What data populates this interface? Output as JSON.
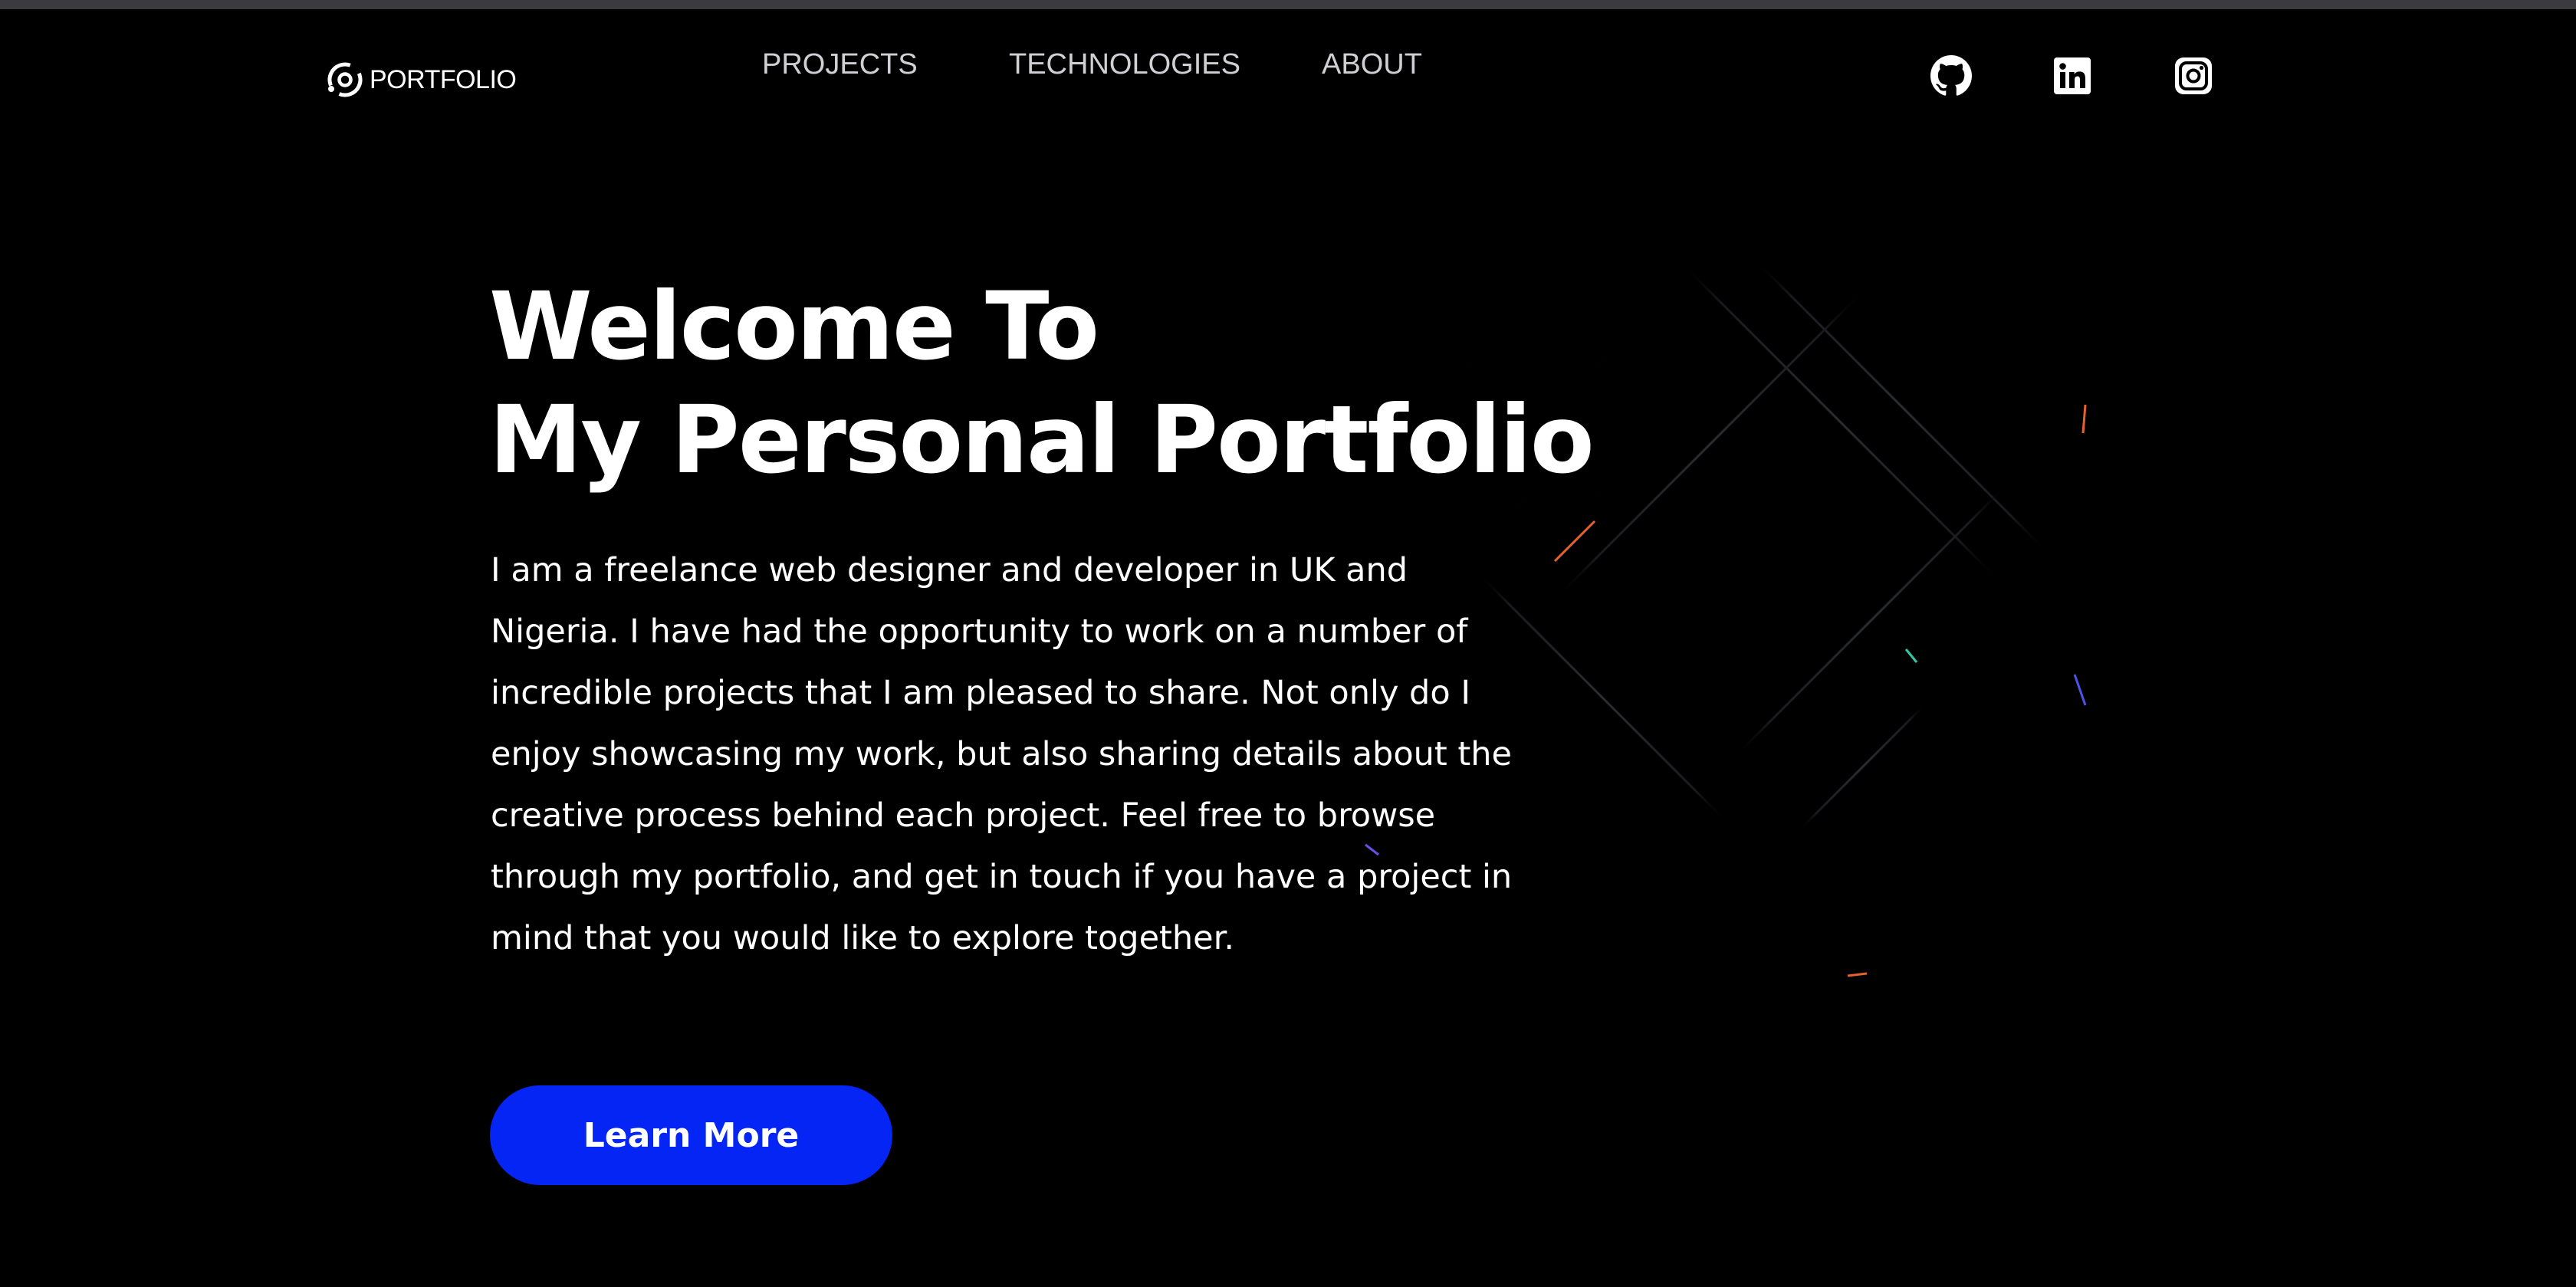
{
  "brand": {
    "logo_text": "PORTFOLIO",
    "logo_icon": "portfolio-ring-icon"
  },
  "nav": {
    "items": [
      {
        "label": "PROJECTS"
      },
      {
        "label": "TECHNOLOGIES"
      },
      {
        "label": "ABOUT"
      }
    ]
  },
  "social": [
    {
      "icon": "github-icon"
    },
    {
      "icon": "linkedin-icon"
    },
    {
      "icon": "instagram-icon"
    }
  ],
  "hero": {
    "title_line1": "Welcome To",
    "title_line2": "My Personal Portfolio",
    "body": "I am a freelance web designer and developer in UK and Nigeria. I have had the opportunity to work on a number of incredible projects that I am pleased to share. Not only do I enjoy showcasing my work, but also sharing details about the creative process behind each project. Feel free to browse through my portfolio, and get in touch if you have a project in mind that you would like to explore together.",
    "cta_label": "Learn More"
  },
  "colors": {
    "background": "#000000",
    "accent": "#0425f4",
    "text": "#ffffff",
    "nav_text": "#cfcfd4"
  }
}
